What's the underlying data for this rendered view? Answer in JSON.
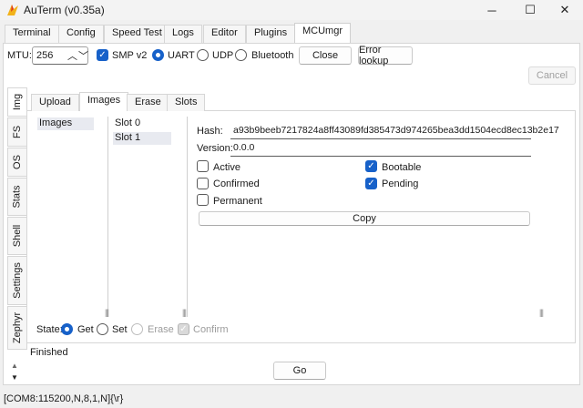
{
  "window": {
    "title": "AuTerm (v0.35a)",
    "minimize": "─",
    "maximize": "☐",
    "close": "✕"
  },
  "main_tabs": [
    "Terminal",
    "Config",
    "Speed Test",
    "Logs",
    "Editor",
    "Plugins",
    "MCUmgr"
  ],
  "toolbar": {
    "mtu_label": "MTU:",
    "mtu_value": "256",
    "smp_v2_label": "SMP v2",
    "transports": [
      "UART",
      "UDP",
      "Bluetooth"
    ],
    "close_label": "Close",
    "error_lookup_label": "Error lookup",
    "cancel_label": "Cancel"
  },
  "side_tabs": [
    "Img",
    "FS",
    "OS",
    "Stats",
    "Shell",
    "Settings",
    "Zephyr"
  ],
  "sub_tabs": [
    "Upload",
    "Images",
    "Erase",
    "Slots"
  ],
  "images_tree": {
    "root": "Images",
    "slots": [
      "Slot 0",
      "Slot 1"
    ]
  },
  "details": {
    "hash_label": "Hash:",
    "hash_value": "a93b9beeb7217824a8ff43089fd385473d974265bea3dd1504ecd8ec13b2e17",
    "version_label": "Version:",
    "version_value": "0.0.0",
    "flags_left": [
      {
        "label": "Active",
        "checked": false
      },
      {
        "label": "Confirmed",
        "checked": false
      },
      {
        "label": "Permanent",
        "checked": false
      }
    ],
    "flags_right": [
      {
        "label": "Bootable",
        "checked": true
      },
      {
        "label": "Pending",
        "checked": true
      }
    ],
    "copy_label": "Copy"
  },
  "state_row": {
    "state_label": "State:",
    "get_label": "Get",
    "set_label": "Set",
    "erase_label": "Erase",
    "confirm_label": "Confirm"
  },
  "status_text": "Finished",
  "go_label": "Go",
  "statusbar": "[COM8:115200,N,8,1,N]{\\r}",
  "colors": {
    "accent": "#1761c9",
    "border": "#d6d6d6",
    "icon_yellow": "#f2b21a",
    "icon_red": "#e03a1e"
  }
}
